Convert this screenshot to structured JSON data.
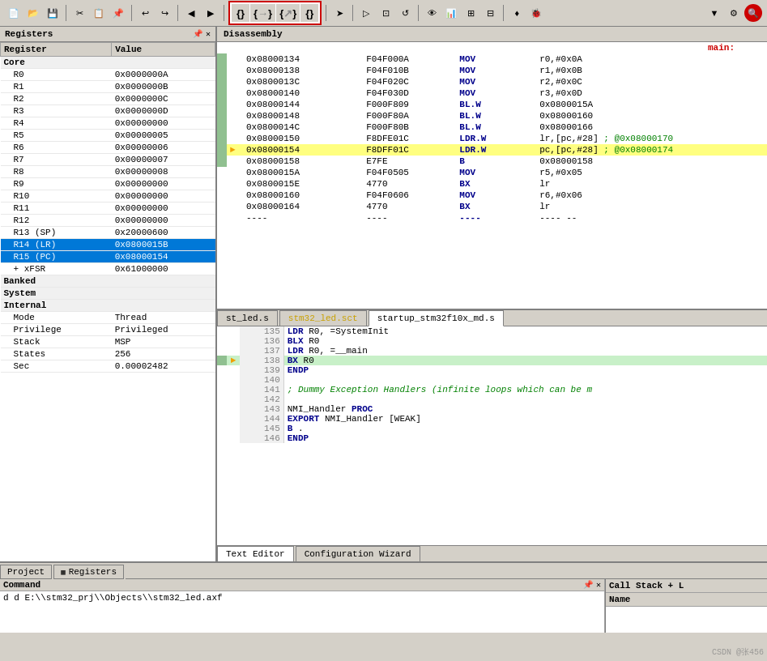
{
  "toolbar": {
    "row1_buttons": [
      "new",
      "open",
      "save",
      "cut",
      "copy",
      "paste",
      "undo",
      "redo",
      "back",
      "forward",
      "bookmark",
      "find",
      "replace",
      "build",
      "debug"
    ],
    "brace_group": [
      "{}",
      "{}",
      "{}",
      "{}"
    ],
    "row2_buttons": [
      "run",
      "step_in",
      "step_over",
      "step_out",
      "reset",
      "breakpoint",
      "watch"
    ]
  },
  "registers_panel": {
    "title": "Registers",
    "col_register": "Register",
    "col_value": "Value",
    "groups": [
      {
        "name": "Core",
        "type": "group"
      },
      {
        "name": "R0",
        "value": "0x0000000A",
        "indent": true
      },
      {
        "name": "R1",
        "value": "0x0000000B",
        "indent": true
      },
      {
        "name": "R2",
        "value": "0x0000000C",
        "indent": true
      },
      {
        "name": "R3",
        "value": "0x0000000D",
        "indent": true
      },
      {
        "name": "R4",
        "value": "0x00000000",
        "indent": true
      },
      {
        "name": "R5",
        "value": "0x00000005",
        "indent": true
      },
      {
        "name": "R6",
        "value": "0x00000006",
        "indent": true
      },
      {
        "name": "R7",
        "value": "0x00000007",
        "indent": true
      },
      {
        "name": "R8",
        "value": "0x00000008",
        "indent": true
      },
      {
        "name": "R9",
        "value": "0x00000000",
        "indent": true
      },
      {
        "name": "R10",
        "value": "0x00000000",
        "indent": true
      },
      {
        "name": "R11",
        "value": "0x00000000",
        "indent": true
      },
      {
        "name": "R12",
        "value": "0x00000000",
        "indent": true
      },
      {
        "name": "R13 (SP)",
        "value": "0x20000600",
        "indent": true
      },
      {
        "name": "R14 (LR)",
        "value": "0x0800015B",
        "indent": true,
        "selected": true
      },
      {
        "name": "R15 (PC)",
        "value": "0x08000154",
        "indent": true,
        "selected": true
      },
      {
        "name": "+ xFSR",
        "value": "0x61000000",
        "indent": true
      },
      {
        "name": "Banked",
        "type": "group"
      },
      {
        "name": "System",
        "type": "group"
      },
      {
        "name": "Internal",
        "type": "group"
      },
      {
        "name": "Mode",
        "value": "Thread",
        "indent": true
      },
      {
        "name": "Privilege",
        "value": "Privileged",
        "indent": true
      },
      {
        "name": "Stack",
        "value": "MSP",
        "indent": true
      },
      {
        "name": "States",
        "value": "256",
        "indent": true
      },
      {
        "name": "Sec",
        "value": "0.00002482",
        "indent": true
      }
    ]
  },
  "disassembly": {
    "title": "Disassembly",
    "rows": [
      {
        "label": "main:",
        "is_label": true
      },
      {
        "addr": "0x08000134",
        "hex": "F04F000A",
        "mnem": "MOV",
        "ops": "r0,#0x0A",
        "comment": "",
        "gutter": true
      },
      {
        "addr": "0x08000138",
        "hex": "F04F010B",
        "mnem": "MOV",
        "ops": "r1,#0x0B",
        "comment": "",
        "gutter": true
      },
      {
        "addr": "0x0800013C",
        "hex": "F04F020C",
        "mnem": "MOV",
        "ops": "r2,#0x0C",
        "comment": "",
        "gutter": true
      },
      {
        "addr": "0x08000140",
        "hex": "F04F030D",
        "mnem": "MOV",
        "ops": "r3,#0x0D",
        "comment": "",
        "gutter": true
      },
      {
        "addr": "0x08000144",
        "hex": "F000F809",
        "mnem": "BL.W",
        "ops": "0x0800015A",
        "comment": "",
        "gutter": true
      },
      {
        "addr": "0x08000148",
        "hex": "F000F80A",
        "mnem": "BL.W",
        "ops": "0x08000160",
        "comment": "",
        "gutter": true
      },
      {
        "addr": "0x0800014C",
        "hex": "F000F80B",
        "mnem": "BL.W",
        "ops": "0x08000166",
        "comment": "",
        "gutter": true
      },
      {
        "addr": "0x08000150",
        "hex": "F8DFE01C",
        "mnem": "LDR.W",
        "ops": "lr,[pc,#28]",
        "comment": "; @0x08000170",
        "gutter": true
      },
      {
        "addr": "0x08000154",
        "hex": "F8DFF01C",
        "mnem": "LDR.W",
        "ops": "pc,[pc,#28]",
        "comment": "; @0x08000174",
        "gutter": true,
        "current": true,
        "arrow": true
      },
      {
        "addr": "0x08000158",
        "hex": "E7FE",
        "mnem": "B",
        "ops": "0x08000158",
        "comment": "",
        "gutter": true
      },
      {
        "addr": "0x0800015A",
        "hex": "F04F0505",
        "mnem": "MOV",
        "ops": "r5,#0x05",
        "comment": ""
      },
      {
        "addr": "0x0800015E",
        "hex": "4770",
        "mnem": "BX",
        "ops": "lr",
        "comment": ""
      },
      {
        "addr": "0x08000160",
        "hex": "F04F0606",
        "mnem": "MOV",
        "ops": "r6,#0x06",
        "comment": ""
      },
      {
        "addr": "0x08000164",
        "hex": "4770",
        "mnem": "BX",
        "ops": "lr",
        "comment": ""
      },
      {
        "addr": "----",
        "hex": "----",
        "mnem": "----",
        "ops": "---- --",
        "comment": ""
      }
    ]
  },
  "editor": {
    "tabs": [
      {
        "label": "st_led.s",
        "active": false,
        "modified": false
      },
      {
        "label": "stm32_led.sct",
        "active": false,
        "modified": true
      },
      {
        "label": "startup_stm32f10x_md.s",
        "active": true,
        "modified": false
      }
    ],
    "bottom_tabs": [
      {
        "label": "Text Editor",
        "active": true
      },
      {
        "label": "Configuration Wizard",
        "active": false
      }
    ],
    "lines": [
      {
        "num": 135,
        "code": "                LDR      R0, =SystemInit",
        "gutter": false,
        "pc": false
      },
      {
        "num": 136,
        "code": "                BLX      R0",
        "gutter": false,
        "pc": false
      },
      {
        "num": 137,
        "code": "                LDR      R0, =__main",
        "gutter": false,
        "pc": false
      },
      {
        "num": 138,
        "code": "                BX       R0",
        "gutter": true,
        "pc": true,
        "arrow": true
      },
      {
        "num": 139,
        "code": "                ENDP",
        "gutter": false,
        "pc": false
      },
      {
        "num": 140,
        "code": "",
        "gutter": false,
        "pc": false
      },
      {
        "num": 141,
        "code": "        ; Dummy Exception Handlers (infinite loops which can be m",
        "comment": true,
        "gutter": false,
        "pc": false
      },
      {
        "num": 142,
        "code": "",
        "gutter": false,
        "pc": false
      },
      {
        "num": 143,
        "code": "NMI_Handler     PROC",
        "gutter": false,
        "pc": false
      },
      {
        "num": 144,
        "code": "                EXPORT   NMI_Handler              [WEAK]",
        "gutter": false,
        "pc": false
      },
      {
        "num": 145,
        "code": "                B        .",
        "gutter": false,
        "pc": false
      },
      {
        "num": 146,
        "code": "                ENDP",
        "gutter": false,
        "pc": false
      }
    ]
  },
  "bottom": {
    "tabs": [
      {
        "label": "Project"
      },
      {
        "label": "Registers",
        "active": true
      }
    ],
    "command": {
      "label": "Command",
      "value": "d E:\\\\stm32_prj\\\\Objects\\\\stm32_led.axf",
      "pin_icon": "📌",
      "close_icon": "✕"
    },
    "callstack": {
      "label": "Call Stack + L",
      "col_name": "Name"
    },
    "watermark": "CSDN @张456"
  }
}
